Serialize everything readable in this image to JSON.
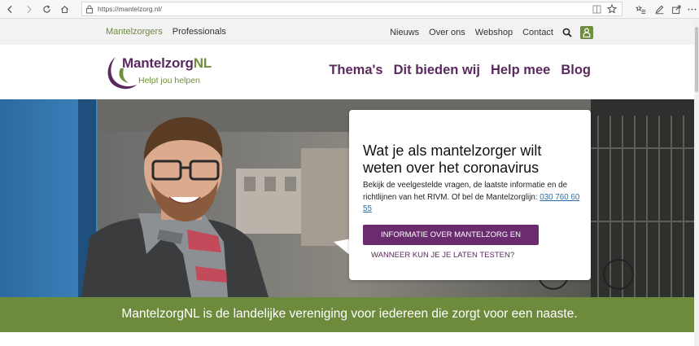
{
  "browser": {
    "url": "https://mantelzorg.nl/",
    "icons": [
      "back-icon",
      "forward-icon",
      "refresh-icon",
      "home-icon",
      "lock-icon",
      "reader-view-icon",
      "favorite-star-icon",
      "favorites-list-icon",
      "notes-icon",
      "share-icon",
      "more-icon"
    ]
  },
  "util_nav": {
    "left": [
      "Mantelzorgers",
      "Professionals"
    ],
    "right": [
      "Nieuws",
      "Over ons",
      "Webshop",
      "Contact"
    ]
  },
  "logo": {
    "name_main": "Mantelzorg",
    "name_suffix": "NL",
    "tagline": "Helpt jou helpen"
  },
  "main_nav": [
    "Thema's",
    "Dit bieden wij",
    "Help mee",
    "Blog"
  ],
  "hero": {
    "title": "Wat je als mantelzorger wilt weten over het coronavirus",
    "body": "Bekijk de veelgestelde vragen, de laatste informatie en de richtlijnen van het RIVM. Of bel de Mantelzorglijn: ",
    "phone": "030 760 60 55",
    "primary_button": "INFORMATIE OVER MANTELZORG EN CORONA",
    "secondary_link": "WANNEER KUN JE JE LATEN TESTEN?"
  },
  "banner": {
    "text": "MantelzorgNL is de landelijke vereniging voor iedereen die zorgt voor een naaste."
  },
  "colors": {
    "purple": "#5a2a5e",
    "button_purple": "#6a2c6e",
    "green": "#6e8b3d"
  }
}
